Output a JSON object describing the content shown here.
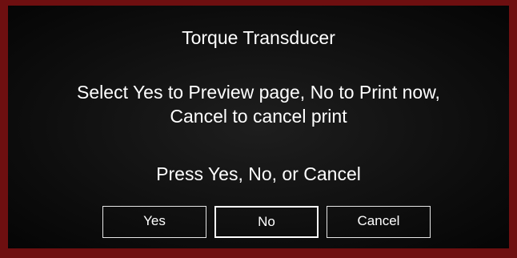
{
  "dialog": {
    "title": "Torque Transducer",
    "message": "Select Yes to Preview page, No to Print now, Cancel to cancel print",
    "prompt": "Press Yes, No, or Cancel",
    "buttons": {
      "yes": "Yes",
      "no": "No",
      "cancel": "Cancel"
    },
    "default_button": "No"
  },
  "colors": {
    "frame": "#6e0f10",
    "background": "#0c0c0c",
    "text": "#ffffff"
  }
}
